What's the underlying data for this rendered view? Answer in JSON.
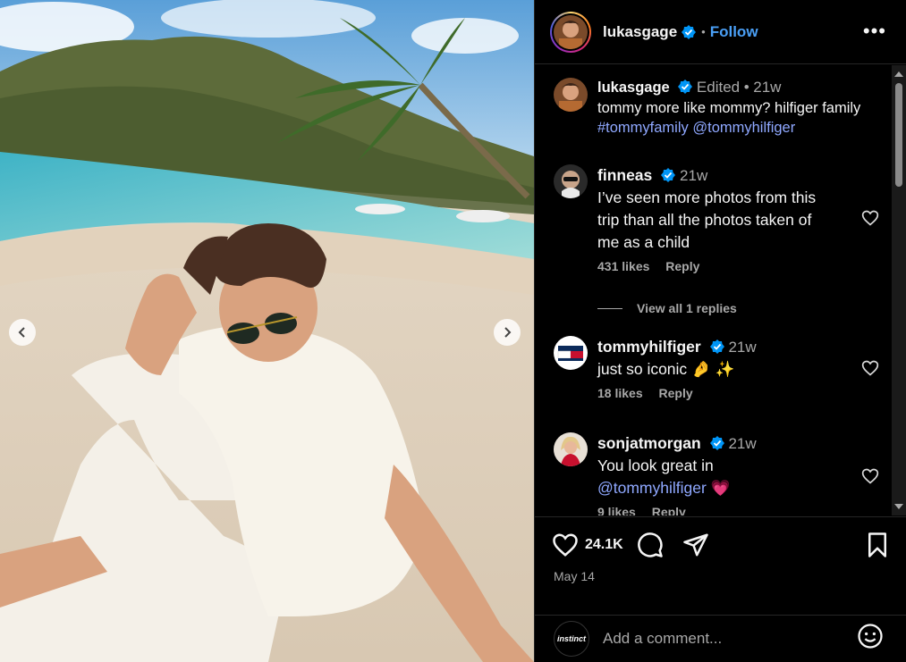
{
  "post": {
    "photo_alt": "Man in white outfit and sunglasses sitting on a tropical beach",
    "header": {
      "username": "lukasgage",
      "follow_label": "Follow",
      "separator": "•",
      "more_label": "•••"
    },
    "caption": {
      "username": "lukasgage",
      "edited": "Edited",
      "separator": "•",
      "time": "21w",
      "text": "tommy more like mommy?  hilfiger family ",
      "hashtag": "#tommyfamily",
      "mention": "@tommyhilfiger"
    },
    "comments": [
      {
        "username": "finneas",
        "time": "21w",
        "text": "I’ve seen more photos from this trip than all the photos taken of me as a child",
        "likes": "431 likes",
        "reply": "Reply"
      },
      {
        "username": "tommyhilfiger",
        "time": "21w",
        "text": "just so iconic",
        "emoji": "🤌 ✨",
        "likes": "18 likes",
        "reply": "Reply"
      },
      {
        "username": "sonjatmorgan",
        "time": "21w",
        "text": "You look great in ",
        "mention": "@tommyhilfiger",
        "emoji": "💗",
        "likes": "9 likes",
        "reply": "Reply"
      }
    ],
    "view_replies": "View all 1 replies",
    "like_count": "24.1K",
    "date": "May 14",
    "add_comment_placeholder": "Add a comment...",
    "current_user_avatar_text": "instinct"
  },
  "icons": {
    "verified": "verified-badge-icon",
    "heart": "heart-icon",
    "comment": "comment-icon",
    "share": "share-icon",
    "save": "bookmark-icon",
    "emoji": "emoji-icon",
    "prev": "chevron-left-icon",
    "next": "chevron-right-icon"
  },
  "colors": {
    "accent": "#4a9ff5",
    "mention": "#8fa8ff",
    "muted": "#a8a8a8",
    "background": "#000000"
  }
}
